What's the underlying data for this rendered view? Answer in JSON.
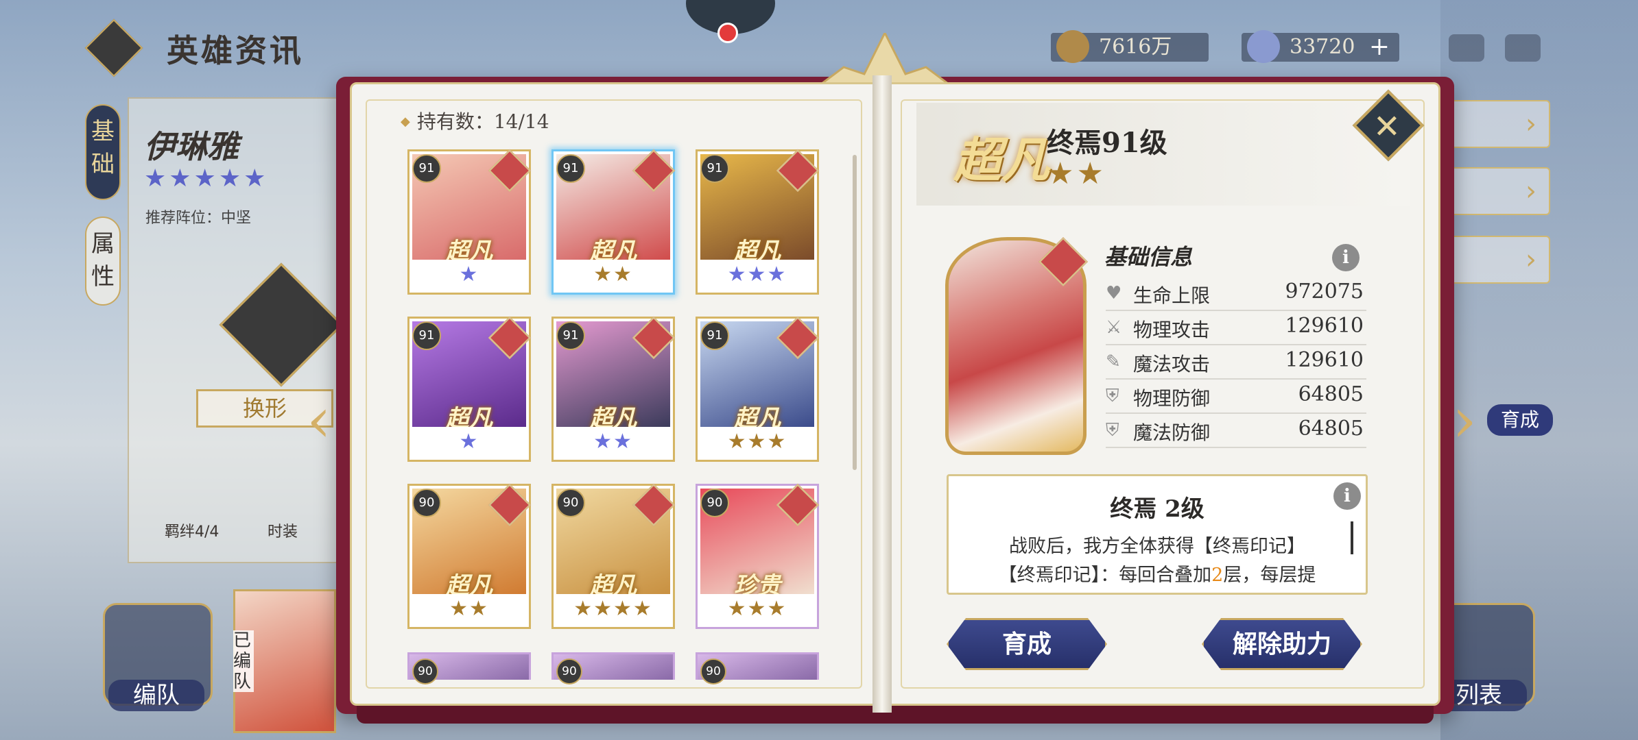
{
  "screen_title": "英雄资讯",
  "currencies": [
    {
      "name": "gold-coin-icon",
      "value": "7616万",
      "has_plus": false
    },
    {
      "name": "diamond-icon",
      "value": "33720",
      "has_plus": true,
      "plus": "+"
    }
  ],
  "background_panel": {
    "tabs": [
      "基础",
      "属性"
    ],
    "hero_name": "伊琳雅",
    "stars": "★★★★★",
    "recommended_position": "推荐阵位：中坚",
    "swap_label": "换形",
    "bond_label": "羁绊4/4",
    "outfit_label": "时装",
    "team_button": "编队",
    "team_tag": "已编队",
    "list_button": "列表",
    "develop_side_label": "育成"
  },
  "owned_count": "持有数：14/14",
  "heroes": [
    {
      "level": "91",
      "rarity": "超凡",
      "stars": "★",
      "star_color": "blue",
      "frame": "gold",
      "selected": false,
      "art_colors": [
        "#f4c8b4",
        "#d86a6a"
      ]
    },
    {
      "level": "91",
      "rarity": "超凡",
      "stars": "★★",
      "star_color": "gold",
      "frame": "gold",
      "selected": true,
      "art_colors": [
        "#f4ece6",
        "#d04a4a"
      ]
    },
    {
      "level": "91",
      "rarity": "超凡",
      "stars": "★★★",
      "star_color": "blue",
      "frame": "gold",
      "selected": false,
      "art_colors": [
        "#e8b84a",
        "#7a4a2a"
      ]
    },
    {
      "level": "91",
      "rarity": "超凡",
      "stars": "★",
      "star_color": "blue",
      "frame": "gold",
      "selected": false,
      "art_colors": [
        "#b57ae4",
        "#5a2a8a"
      ]
    },
    {
      "level": "91",
      "rarity": "超凡",
      "stars": "★★",
      "star_color": "blue",
      "frame": "gold",
      "selected": false,
      "art_colors": [
        "#e49ad0",
        "#3a3a5a"
      ]
    },
    {
      "level": "91",
      "rarity": "超凡",
      "stars": "★★★",
      "star_color": "gold",
      "frame": "gold",
      "selected": false,
      "art_colors": [
        "#c8d8f0",
        "#3a4a8a"
      ]
    },
    {
      "level": "90",
      "rarity": "超凡",
      "stars": "★★",
      "star_color": "gold",
      "frame": "gold",
      "selected": false,
      "art_colors": [
        "#f4d8a0",
        "#d07a30"
      ]
    },
    {
      "level": "90",
      "rarity": "超凡",
      "stars": "★★★★",
      "star_color": "gold",
      "frame": "gold",
      "selected": false,
      "art_colors": [
        "#f0d8a0",
        "#c89040"
      ]
    },
    {
      "level": "90",
      "rarity": "珍贵",
      "stars": "★★★",
      "star_color": "gold",
      "frame": "purple",
      "selected": false,
      "art_colors": [
        "#e84a5a",
        "#f0e0d0"
      ]
    }
  ],
  "partial_heroes": [
    {
      "level": "90"
    },
    {
      "level": "90"
    },
    {
      "level": "90"
    }
  ],
  "detail": {
    "rarity": "超凡",
    "name_level": "终焉91级",
    "stars": "★★",
    "section_title": "基础信息",
    "info_glyph": "i",
    "stats": [
      {
        "icon": "heart-icon",
        "glyph": "♥",
        "label": "生命上限",
        "value": "972075"
      },
      {
        "icon": "sword-icon",
        "glyph": "⚔",
        "label": "物理攻击",
        "value": "129610"
      },
      {
        "icon": "wand-icon",
        "glyph": "✎",
        "label": "魔法攻击",
        "value": "129610"
      },
      {
        "icon": "shield-icon",
        "glyph": "⛨",
        "label": "物理防御",
        "value": "64805"
      },
      {
        "icon": "magic-shield-icon",
        "glyph": "⛨",
        "label": "魔法防御",
        "value": "64805"
      }
    ],
    "skill": {
      "title": "终焉 2级",
      "line1": "战败后，我方全体获得【终焉印记】",
      "line2_a": "【终焉印记】：每回合叠加",
      "line2_hl": "2",
      "line2_b": "层，每层提"
    },
    "develop_button": "育成",
    "release_button": "解除助力",
    "close_glyph": "✕"
  },
  "colors": {
    "book_cover": "#7a1e36",
    "gold_trim": "#c8a860",
    "selected_frame": "#70c6f4",
    "action_button": "#2f3a7a",
    "highlight": "#e78a1a"
  }
}
